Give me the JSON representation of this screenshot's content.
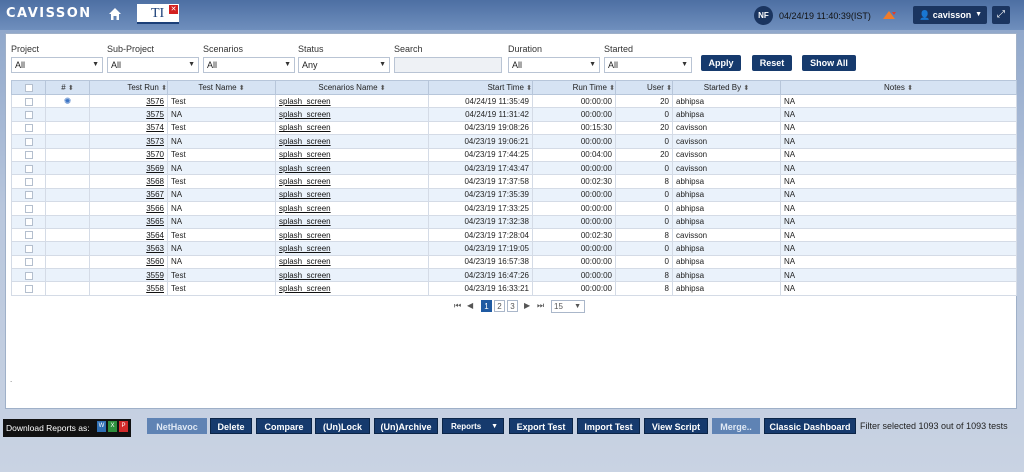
{
  "header": {
    "logo": "CAVISSON",
    "app_logo": "TI",
    "avatar_initials": "NF",
    "datetime": "04/24/19 11:40:39(IST)",
    "username": "cavisson"
  },
  "filters": [
    {
      "label": "Project",
      "value": "All"
    },
    {
      "label": "Sub-Project",
      "value": "All"
    },
    {
      "label": "Scenarios",
      "value": "All"
    },
    {
      "label": "Status",
      "value": "Any"
    },
    {
      "label": "Search",
      "value": ""
    },
    {
      "label": "Duration",
      "value": "All"
    },
    {
      "label": "Started",
      "value": "All"
    }
  ],
  "filter_buttons": {
    "apply": "Apply",
    "reset": "Reset",
    "show_all": "Show All"
  },
  "table": {
    "columns": [
      "#",
      "Test Run",
      "Test Name",
      "Scenarios Name",
      "Start Time",
      "Run Time",
      "User",
      "Started By",
      "Notes"
    ],
    "rows": [
      {
        "run": "3576",
        "name": "Test",
        "scenario": "splash_screen",
        "start": "04/24/19 11:35:49",
        "runtime": "00:00:00",
        "user": "20",
        "by": "abhipsa",
        "notes": "NA",
        "running": true
      },
      {
        "run": "3575",
        "name": "NA",
        "scenario": "splash_screen",
        "start": "04/24/19 11:31:42",
        "runtime": "00:00:00",
        "user": "0",
        "by": "abhipsa",
        "notes": "NA"
      },
      {
        "run": "3574",
        "name": "Test",
        "scenario": "splash_screen",
        "start": "04/23/19 19:08:26",
        "runtime": "00:15:30",
        "user": "20",
        "by": "cavisson",
        "notes": "NA"
      },
      {
        "run": "3573",
        "name": "NA",
        "scenario": "splash_screen",
        "start": "04/23/19 19:06:21",
        "runtime": "00:00:00",
        "user": "0",
        "by": "cavisson",
        "notes": "NA"
      },
      {
        "run": "3570",
        "name": "Test",
        "scenario": "splash_screen",
        "start": "04/23/19 17:44:25",
        "runtime": "00:04:00",
        "user": "20",
        "by": "cavisson",
        "notes": "NA"
      },
      {
        "run": "3569",
        "name": "NA",
        "scenario": "splash_screen",
        "start": "04/23/19 17:43:47",
        "runtime": "00:00:00",
        "user": "0",
        "by": "cavisson",
        "notes": "NA"
      },
      {
        "run": "3568",
        "name": "Test",
        "scenario": "splash_screen",
        "start": "04/23/19 17:37:58",
        "runtime": "00:02:30",
        "user": "8",
        "by": "abhipsa",
        "notes": "NA"
      },
      {
        "run": "3567",
        "name": "NA",
        "scenario": "splash_screen",
        "start": "04/23/19 17:35:39",
        "runtime": "00:00:00",
        "user": "0",
        "by": "abhipsa",
        "notes": "NA"
      },
      {
        "run": "3566",
        "name": "NA",
        "scenario": "splash_screen",
        "start": "04/23/19 17:33:25",
        "runtime": "00:00:00",
        "user": "0",
        "by": "abhipsa",
        "notes": "NA"
      },
      {
        "run": "3565",
        "name": "NA",
        "scenario": "splash_screen",
        "start": "04/23/19 17:32:38",
        "runtime": "00:00:00",
        "user": "0",
        "by": "abhipsa",
        "notes": "NA"
      },
      {
        "run": "3564",
        "name": "Test",
        "scenario": "splash_screen",
        "start": "04/23/19 17:28:04",
        "runtime": "00:02:30",
        "user": "8",
        "by": "cavisson",
        "notes": "NA"
      },
      {
        "run": "3563",
        "name": "NA",
        "scenario": "splash_screen",
        "start": "04/23/19 17:19:05",
        "runtime": "00:00:00",
        "user": "0",
        "by": "abhipsa",
        "notes": "NA"
      },
      {
        "run": "3560",
        "name": "NA",
        "scenario": "splash_screen",
        "start": "04/23/19 16:57:38",
        "runtime": "00:00:00",
        "user": "0",
        "by": "abhipsa",
        "notes": "NA"
      },
      {
        "run": "3559",
        "name": "Test",
        "scenario": "splash_screen",
        "start": "04/23/19 16:47:26",
        "runtime": "00:00:00",
        "user": "8",
        "by": "abhipsa",
        "notes": "NA"
      },
      {
        "run": "3558",
        "name": "Test",
        "scenario": "splash_screen",
        "start": "04/23/19 16:33:21",
        "runtime": "00:00:00",
        "user": "8",
        "by": "abhipsa",
        "notes": "NA"
      }
    ]
  },
  "pager": {
    "pages": [
      "1",
      "2",
      "3"
    ],
    "current": "1",
    "page_size": "15"
  },
  "download": {
    "label": "Download Reports as:"
  },
  "actions": [
    {
      "label": "NetHavoc",
      "disabled": true
    },
    {
      "label": "Delete"
    },
    {
      "label": "Compare"
    },
    {
      "label": "(Un)Lock"
    },
    {
      "label": "(Un)Archive"
    },
    {
      "label": "Reports"
    },
    {
      "label": "Export Test"
    },
    {
      "label": "Import Test"
    },
    {
      "label": "View Script"
    },
    {
      "label": "Merge..",
      "disabled": true
    },
    {
      "label": "Classic Dashboard"
    }
  ],
  "filter_status": "Filter selected 1093 out of 1093 tests",
  "colors": {
    "primary_dark": "#163a6d",
    "header_row": "#d6e3f3",
    "alt_row": "#eaf2fb",
    "active_page": "#1f5aa2"
  }
}
